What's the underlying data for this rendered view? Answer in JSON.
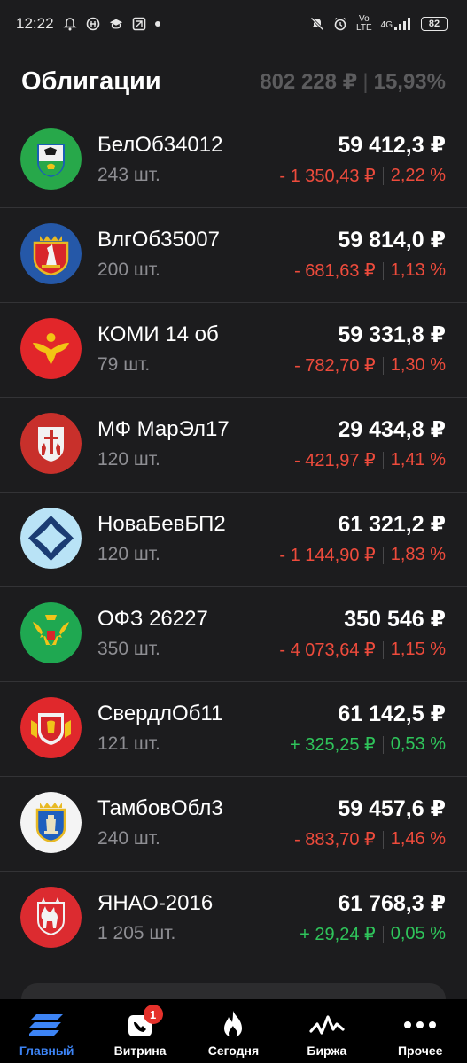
{
  "status_bar": {
    "time": "12:22",
    "network_top": "Vo",
    "network_bottom": "LTE",
    "signal_label": "4G",
    "battery": "82"
  },
  "header": {
    "title": "Облигации",
    "total": "802 228 ₽",
    "yield": "15,93%"
  },
  "bonds": [
    {
      "name": "БелОб34012",
      "qty": "243 шт.",
      "value": "59 412,3 ₽",
      "change": "- 1 350,43 ₽",
      "pct": "2,22 %",
      "trend": "neg",
      "logo": "belgorod-coat-of-arms"
    },
    {
      "name": "ВлгОб35007",
      "qty": "200 шт.",
      "value": "59 814,0 ₽",
      "change": "- 681,63 ₽",
      "pct": "1,13 %",
      "trend": "neg",
      "logo": "volgograd-coat-of-arms"
    },
    {
      "name": "КОМИ 14 об",
      "qty": "79 шт.",
      "value": "59 331,8 ₽",
      "change": "- 782,70 ₽",
      "pct": "1,30 %",
      "trend": "neg",
      "logo": "komi-coat-of-arms"
    },
    {
      "name": "МФ МарЭл17",
      "qty": "120 шт.",
      "value": "29 434,8 ₽",
      "change": "- 421,97 ₽",
      "pct": "1,41 %",
      "trend": "neg",
      "logo": "mari-el-coat-of-arms"
    },
    {
      "name": "НоваБевБП2",
      "qty": "120 шт.",
      "value": "61 321,2 ₽",
      "change": "- 1 144,90 ₽",
      "pct": "1,83 %",
      "trend": "neg",
      "logo": "novabev-logo"
    },
    {
      "name": "ОФЗ 26227",
      "qty": "350 шт.",
      "value": "350 546 ₽",
      "change": "- 4 073,64 ₽",
      "pct": "1,15 %",
      "trend": "neg",
      "logo": "russia-coat-of-arms"
    },
    {
      "name": "СвердлОб11",
      "qty": "121 шт.",
      "value": "61 142,5 ₽",
      "change": "+ 325,25 ₽",
      "pct": "0,53 %",
      "trend": "pos",
      "logo": "sverdlovsk-coat-of-arms"
    },
    {
      "name": "ТамбовОбл3",
      "qty": "240 шт.",
      "value": "59 457,6 ₽",
      "change": "- 883,70 ₽",
      "pct": "1,46 %",
      "trend": "neg",
      "logo": "tambov-coat-of-arms"
    },
    {
      "name": "ЯНАО-2016",
      "qty": "1 205 шт.",
      "value": "61 768,3 ₽",
      "change": "+ 29,24 ₽",
      "pct": "0,05 %",
      "trend": "pos",
      "logo": "yanao-coat-of-arms"
    }
  ],
  "nav": [
    {
      "label": "Главный",
      "icon": "home-stripes-icon",
      "active": true
    },
    {
      "label": "Витрина",
      "icon": "showcase-icon",
      "badge": "1"
    },
    {
      "label": "Сегодня",
      "icon": "flame-icon"
    },
    {
      "label": "Биржа",
      "icon": "exchange-chart-icon"
    },
    {
      "label": "Прочее",
      "icon": "more-dots-icon"
    }
  ],
  "colors": {
    "background": "#1c1c1e",
    "negative": "#ee4b3c",
    "positive": "#2fc55b",
    "accent": "#3d84f5"
  }
}
